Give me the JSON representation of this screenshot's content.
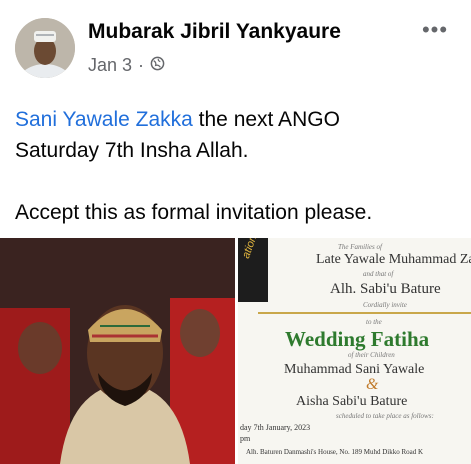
{
  "post": {
    "author": "Mubarak Jibril Yankyaure",
    "date": "Jan 3",
    "audience_icon": "globe-icon",
    "more_icon": "more-options-icon",
    "text": {
      "mention": "Sani Yawale Zakka",
      "line1_rest": " the next ANGO",
      "line2": "Saturday 7th Insha Allah.",
      "line3": "Accept this as formal invitation please."
    },
    "mention_color": "#216fdb"
  },
  "card": {
    "corner_text": "ation",
    "families": "The Families of",
    "name1": "Late Yawale Muhammad Zakka",
    "and_that": "and that of",
    "name2": "Alh. Sabi'u Bature",
    "cordially": "Cordially invite",
    "to_the": "to the",
    "event": "Wedding Fatiha",
    "of_children": "of their Children",
    "groom": "Muhammad Sani Yawale",
    "amp": "&",
    "bride": "Aisha Sabi'u Bature",
    "scheduled": "scheduled to take place as follows:",
    "date": "day 7th January, 2023",
    "time": "pm",
    "venue": "Alh. Baturen Danmashi's House, No. 189 Muhd Dikko Road K"
  }
}
